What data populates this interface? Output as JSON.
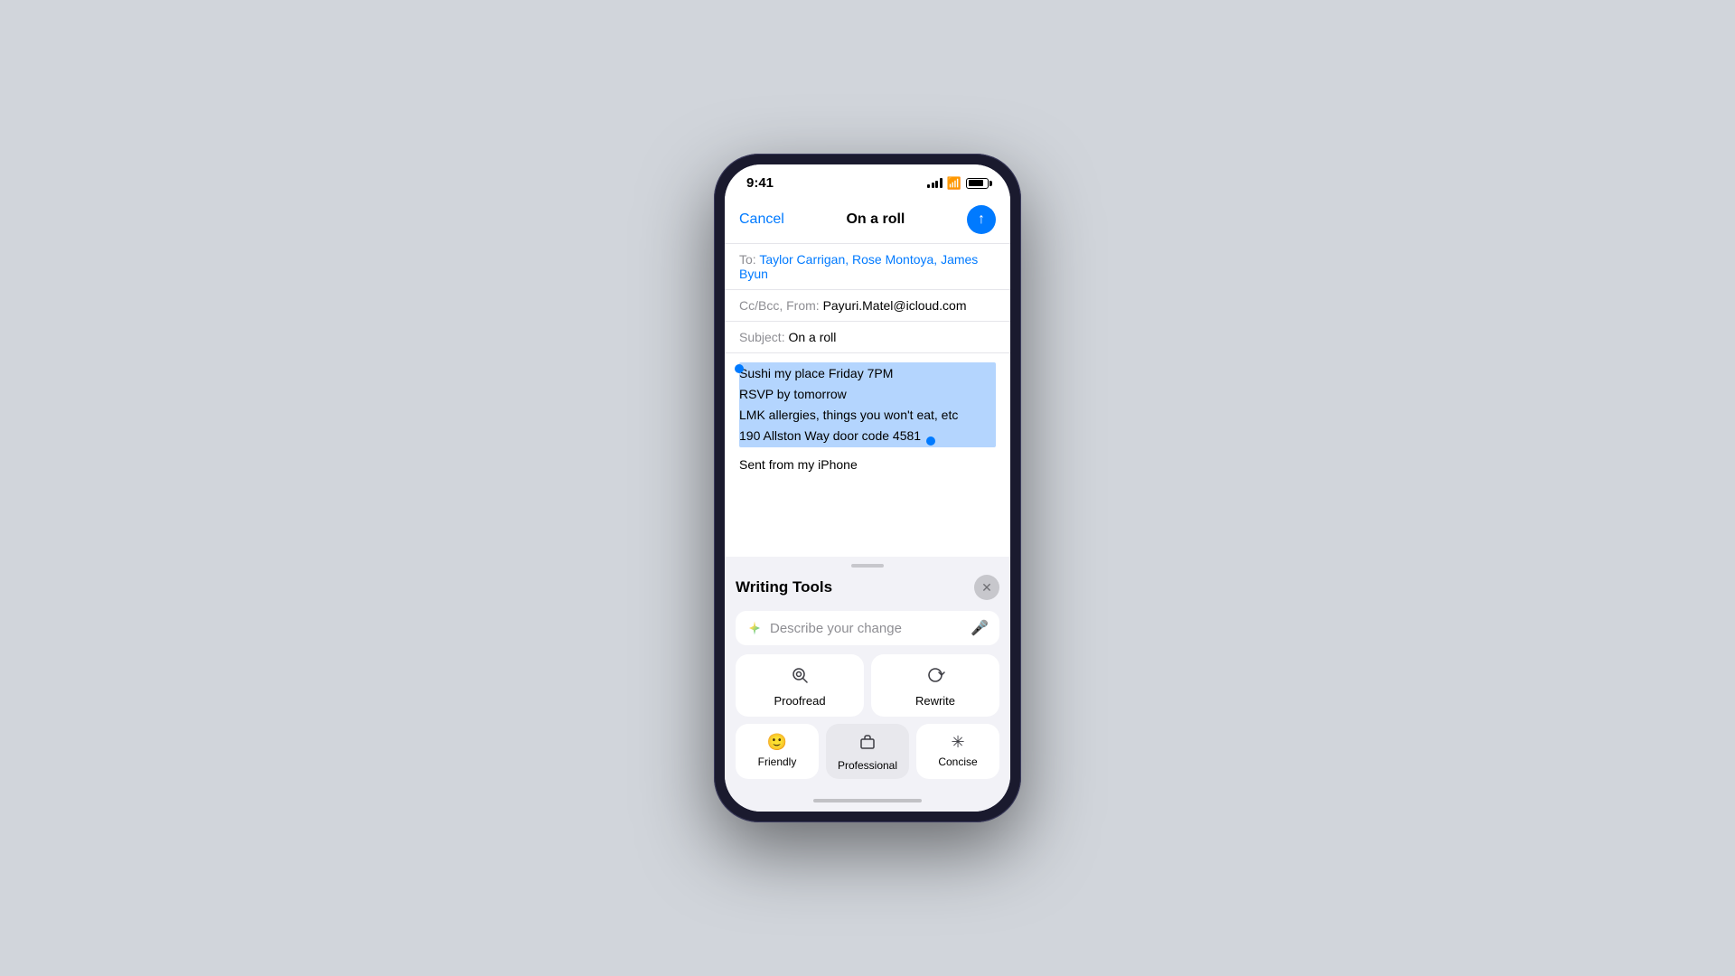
{
  "phone": {
    "status_bar": {
      "time": "9:41",
      "signal_label": "signal",
      "wifi_label": "wifi",
      "battery_label": "battery"
    },
    "compose": {
      "cancel_label": "Cancel",
      "title": "On a roll",
      "to_label": "To: ",
      "to_value": "Taylor Carrigan, Rose Montoya, James Byun",
      "cc_label": "Cc/Bcc, From: ",
      "cc_value": "Payuri.Matel@icloud.com",
      "subject_label": "Subject: ",
      "subject_value": "On a roll",
      "body_lines": [
        "Sushi my place Friday 7PM",
        "RSVP by tomorrow",
        "LMK allergies, things you won't eat, etc",
        "190 Allston Way door code 4581"
      ],
      "signature": "Sent from my iPhone"
    },
    "writing_tools": {
      "title": "Writing Tools",
      "input_placeholder": "Describe your change",
      "proofread_label": "Proofread",
      "rewrite_label": "Rewrite",
      "friendly_label": "Friendly",
      "professional_label": "Professional",
      "concise_label": "Concise"
    }
  }
}
